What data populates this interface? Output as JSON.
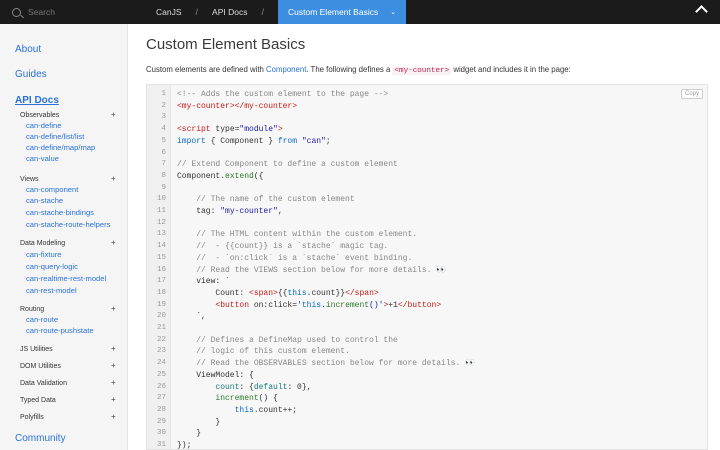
{
  "topbar": {
    "search_placeholder": "Search",
    "breadcrumbs": [
      "CanJS",
      "API Docs",
      "Custom Element Basics"
    ],
    "separator": "/"
  },
  "sidebar": {
    "top_links": [
      "About",
      "Guides",
      "API Docs"
    ],
    "groups": [
      {
        "label": "Observables",
        "items": [
          "can-define",
          "can-define/list/list",
          "can-define/map/map",
          "can-value"
        ]
      },
      {
        "label": "Views",
        "items": [
          "can-component",
          "can-stache",
          "can-stache-bindings",
          "can-stache-route-helpers"
        ]
      },
      {
        "label": "Data Modeling",
        "items": [
          "can-fixture",
          "can-query-logic",
          "can-realtime-rest-model",
          "can-rest-model"
        ]
      },
      {
        "label": "Routing",
        "items": [
          "can-route",
          "can-route-pushstate"
        ]
      },
      {
        "label": "JS Utilities",
        "items": []
      },
      {
        "label": "DOM Utilities",
        "items": []
      },
      {
        "label": "Data Validation",
        "items": []
      },
      {
        "label": "Typed Data",
        "items": []
      },
      {
        "label": "Polyfills",
        "items": []
      }
    ],
    "bottom_link": "Community"
  },
  "main": {
    "title": "Custom Element Basics",
    "intro_prefix": "Custom elements are defined with ",
    "intro_link": "Component",
    "intro_middle": ". The following defines a ",
    "intro_code": "<my-counter>",
    "intro_suffix": " widget and includes it in the page:",
    "copy_label": "Copy"
  },
  "code_lines": [
    "<!-- Adds the custom element to the page -->",
    "<my-counter></my-counter>",
    "",
    "<script type=\"module\">",
    "import { Component } from \"can\";",
    "",
    "// Extend Component to define a custom element",
    "Component.extend({",
    "",
    "    // The name of the custom element",
    "    tag: \"my-counter\",",
    "",
    "    // The HTML content within the custom element.",
    "    //  - {{count}} is a `stache` magic tag.",
    "    //  - `on:click` is a `stache` event binding.",
    "    // Read the VIEWS section below for more details. 👀",
    "    view: `",
    "        Count: <span>{{this.count}}</span>",
    "        <button on:click='this.increment()'>+1</button>",
    "    `,",
    "",
    "    // Defines a DefineMap used to control the",
    "    // logic of this custom element.",
    "    // Read the OBSERVABLES section below for more details. 👀",
    "    ViewModel: {",
    "        count: {default: 0},",
    "        increment() {",
    "            this.count++;",
    "        }",
    "    }",
    "});"
  ]
}
